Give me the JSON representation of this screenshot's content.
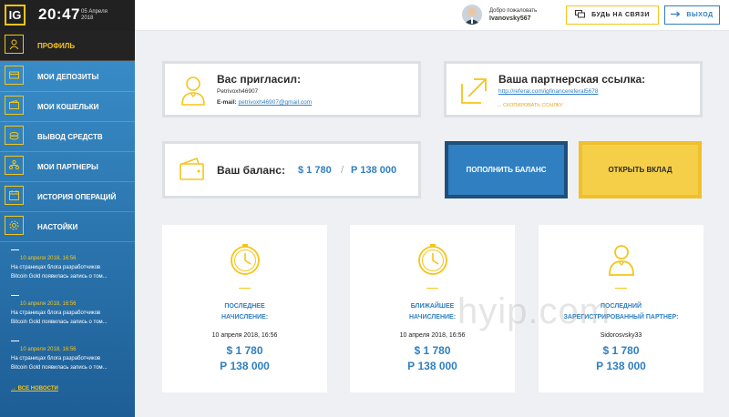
{
  "header": {
    "logo_text": "IG",
    "time": "20:47",
    "date_day_month": "05 Апреля",
    "date_year": "2018",
    "welcome": "Добро пожаловать",
    "username": "Ivanovsky567",
    "support_label": "БУДЬ НА СВЯЗИ",
    "logout_label": "ВЫХОД"
  },
  "sidebar": {
    "items": [
      {
        "label": "ПРОФИЛЬ",
        "icon": "profile-icon"
      },
      {
        "label": "МОИ ДЕПОЗИТЫ",
        "icon": "deposits-icon"
      },
      {
        "label": "МОИ КОШЕЛЬКИ",
        "icon": "wallet-icon"
      },
      {
        "label": "ВЫВОД СРЕДСТВ",
        "icon": "withdraw-icon"
      },
      {
        "label": "МОИ ПАРТНЕРЫ",
        "icon": "partners-icon"
      },
      {
        "label": "ИСТОРИЯ ОПЕРАЦИЙ",
        "icon": "calendar-icon"
      },
      {
        "label": "НАСТОЙКИ",
        "icon": "gear-icon"
      }
    ],
    "news": [
      {
        "date": "10 апреля 2018, 16:56",
        "line1": "На страницах блога разработчиков",
        "line2": "Bitcoin Gold появилась запись о том..."
      },
      {
        "date": "10 апреля 2018, 16:56",
        "line1": "На страницах блога разработчиков",
        "line2": "Bitcoin Gold появилась запись о том..."
      },
      {
        "date": "10 апреля 2018, 16:56",
        "line1": "На страницах блога разработчиков",
        "line2": "Bitcoin Gold появилась запись о том..."
      }
    ],
    "all_news_label": "ВСЕ НОВОСТИ"
  },
  "inviter": {
    "title": "Вас пригласил:",
    "name": "Petrivoxh46907",
    "email_label": "E-mail:",
    "email": "petrivoxh46907@gmail.com"
  },
  "referral": {
    "title": "Ваша партнерская ссылка:",
    "url": "http://referal.com/igfinancereferal5678",
    "copy_label": "СКОПИРОВАТЬ ССЫЛКУ"
  },
  "balance": {
    "title": "Ваш баланс:",
    "usd": "$ 1 780",
    "separator": "/",
    "rub": "Р 138 000"
  },
  "actions": {
    "deposit_label": "ПОПОЛНИТЬ БАЛАНС",
    "open_label": "ОТКРЫТЬ ВКЛАД"
  },
  "stats": [
    {
      "label1": "ПОСЛЕДНЕЕ",
      "label2": "НАЧИСЛЕНИЕ:",
      "value": "10 апреля 2018, 16:56",
      "usd": "$ 1 780",
      "rub": "Р 138 000",
      "icon": "clock-icon"
    },
    {
      "label1": "БЛИЖАЙШЕЕ",
      "label2": "НАЧИСЛЕНИЕ:",
      "value": "10 апреля 2018, 16:56",
      "usd": "$ 1 780",
      "rub": "Р 138 000",
      "icon": "clock-icon"
    },
    {
      "label1": "ПОСЛЕДНИЙ",
      "label2": "ЗАРЕГИСТРИРОВАННЫЙ ПАРТНЕР:",
      "value": "Sidorosvsky33",
      "usd": "$ 1 780",
      "rub": "Р 138 000",
      "icon": "user-icon"
    }
  ],
  "watermark": "hyip.com",
  "colors": {
    "accent_yellow": "#f5c518",
    "accent_blue": "#2f7fc1",
    "dark": "#232323"
  }
}
